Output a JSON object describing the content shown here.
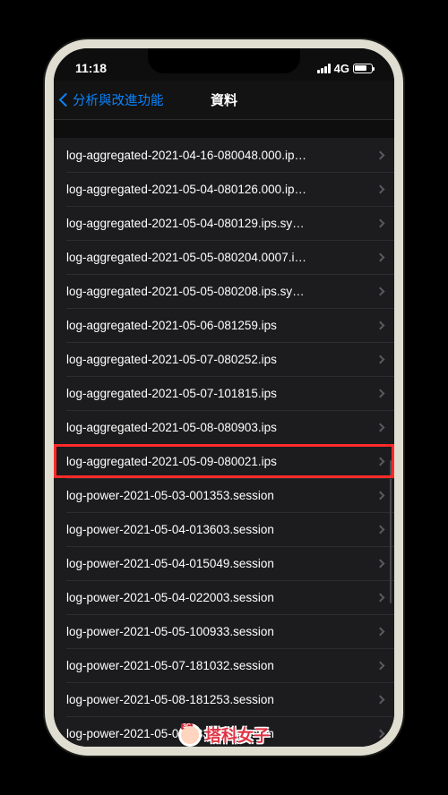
{
  "status": {
    "time": "11:18",
    "network": "4G"
  },
  "nav": {
    "back_label": "分析與改進功能",
    "title": "資料"
  },
  "rows": [
    {
      "label": "log-aggregated-2021-04-16-080048.000.ip…",
      "highlighted": false
    },
    {
      "label": "log-aggregated-2021-05-04-080126.000.ip…",
      "highlighted": false
    },
    {
      "label": "log-aggregated-2021-05-04-080129.ips.sy…",
      "highlighted": false
    },
    {
      "label": "log-aggregated-2021-05-05-080204.0007.i…",
      "highlighted": false
    },
    {
      "label": "log-aggregated-2021-05-05-080208.ips.sy…",
      "highlighted": false
    },
    {
      "label": "log-aggregated-2021-05-06-081259.ips",
      "highlighted": false
    },
    {
      "label": "log-aggregated-2021-05-07-080252.ips",
      "highlighted": false
    },
    {
      "label": "log-aggregated-2021-05-07-101815.ips",
      "highlighted": false
    },
    {
      "label": "log-aggregated-2021-05-08-080903.ips",
      "highlighted": false
    },
    {
      "label": "log-aggregated-2021-05-09-080021.ips",
      "highlighted": true
    },
    {
      "label": "log-power-2021-05-03-001353.session",
      "highlighted": false
    },
    {
      "label": "log-power-2021-05-04-013603.session",
      "highlighted": false
    },
    {
      "label": "log-power-2021-05-04-015049.session",
      "highlighted": false
    },
    {
      "label": "log-power-2021-05-04-022003.session",
      "highlighted": false
    },
    {
      "label": "log-power-2021-05-05-100933.session",
      "highlighted": false
    },
    {
      "label": "log-power-2021-05-07-181032.session",
      "highlighted": false
    },
    {
      "label": "log-power-2021-05-08-181253.session",
      "highlighted": false
    },
    {
      "label": "log-power-2021-05-09-183241.session",
      "highlighted": false
    }
  ],
  "watermark": {
    "badge": "3C",
    "text": "塔科女子"
  }
}
